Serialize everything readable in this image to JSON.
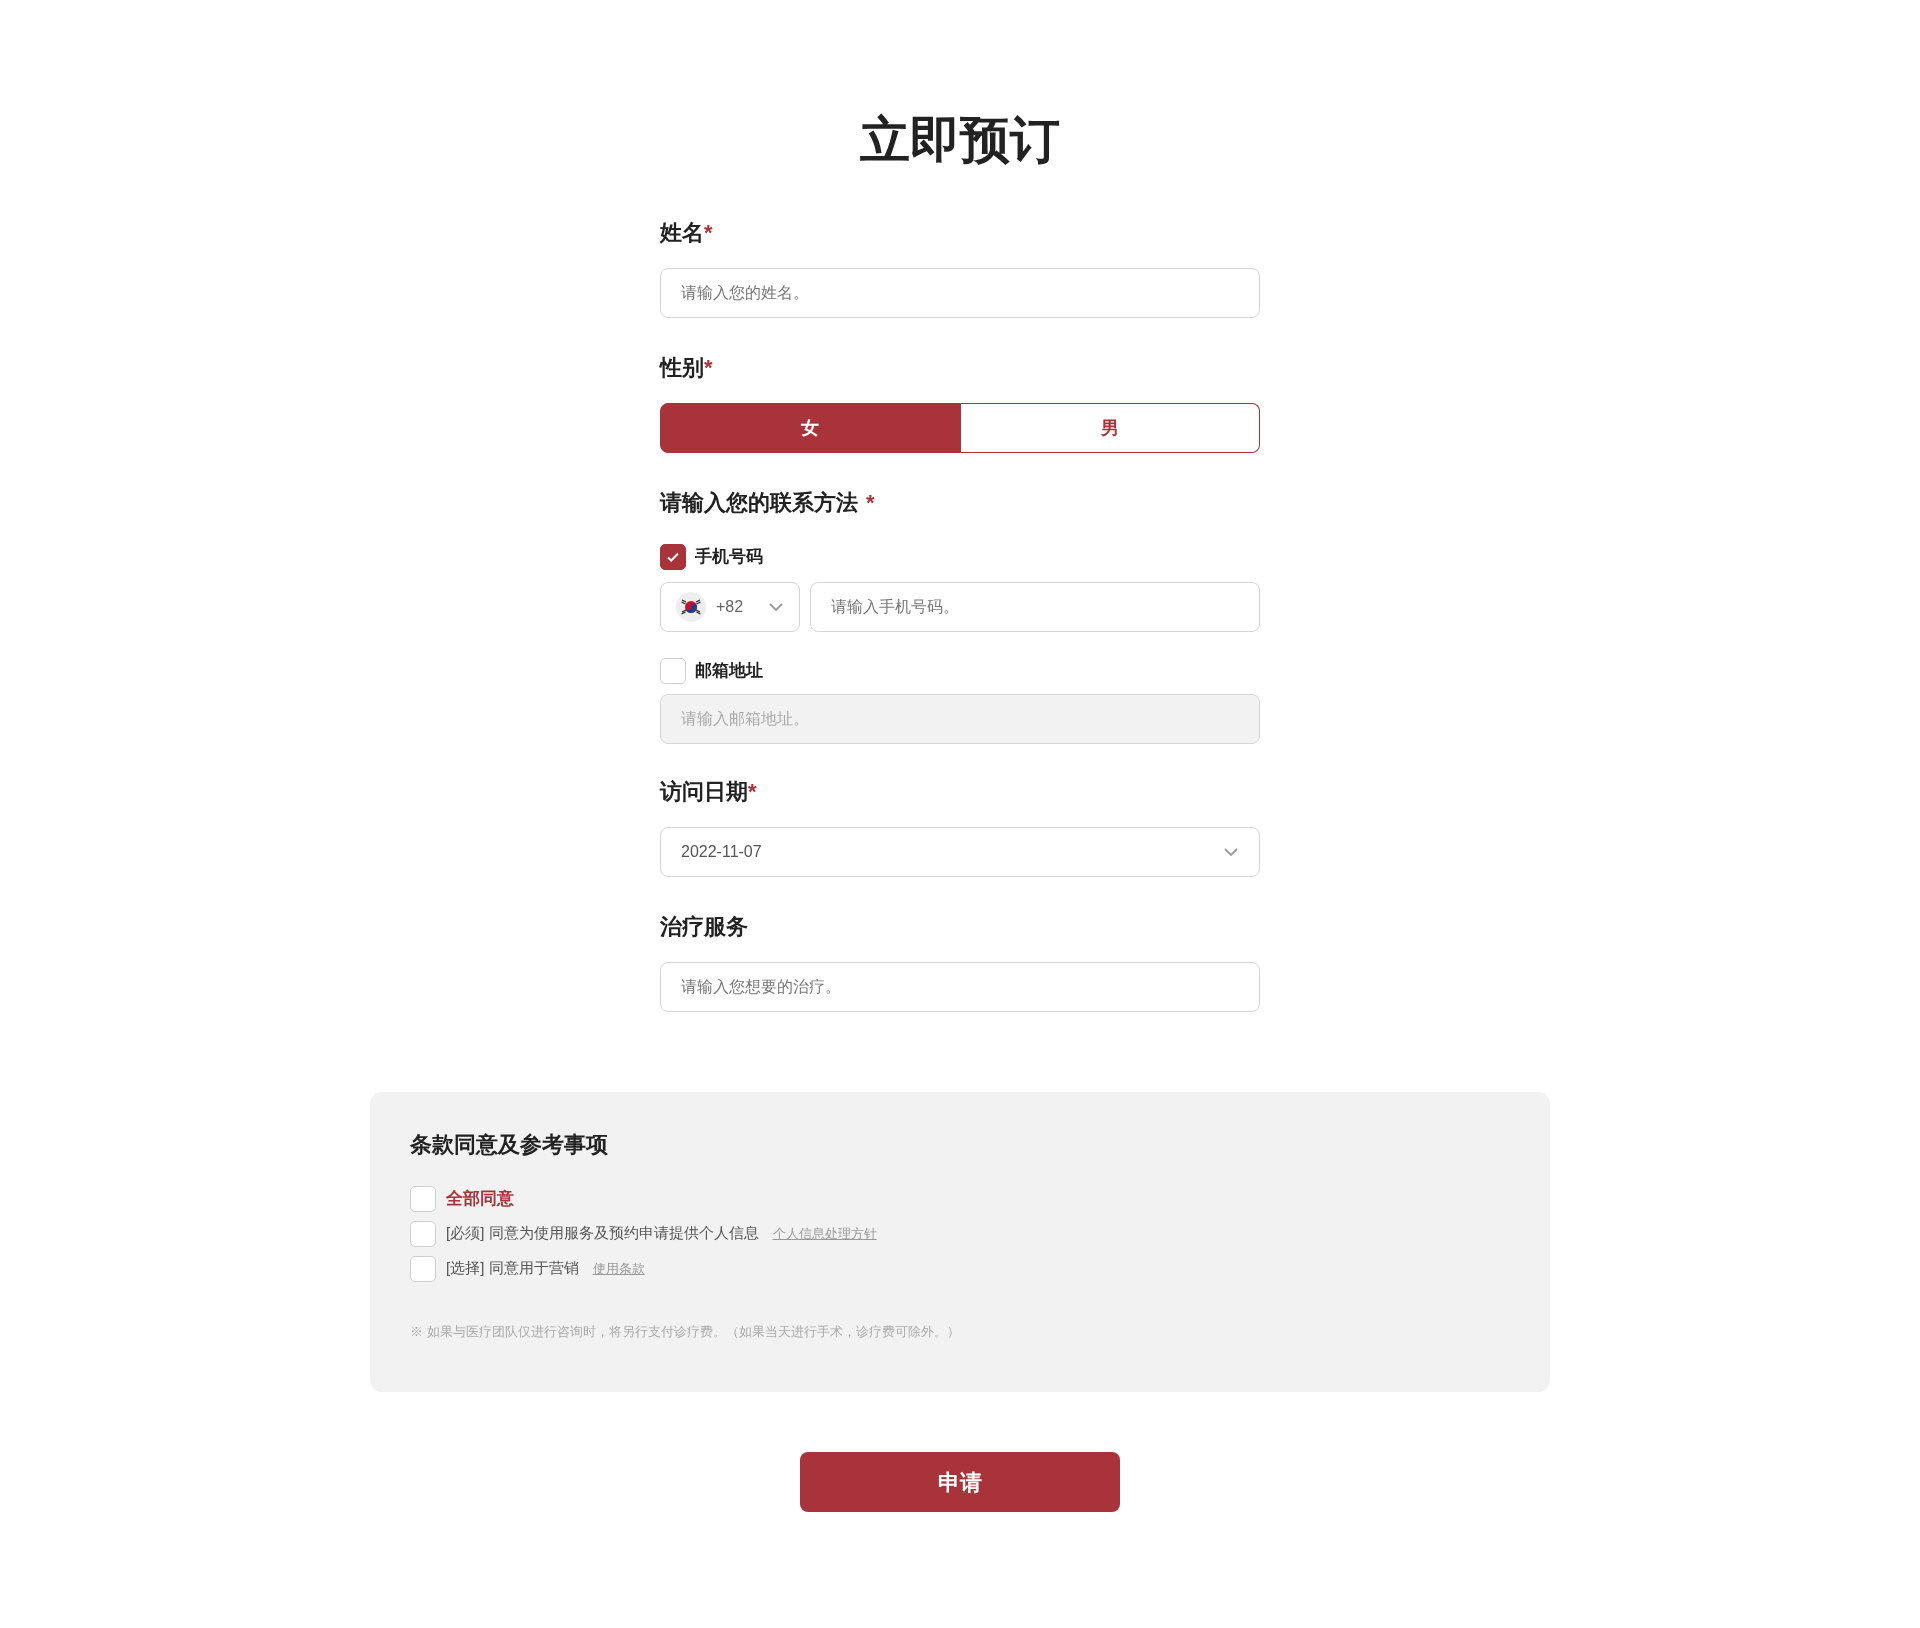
{
  "title": "立即预订",
  "name_field": {
    "label": "姓名",
    "required_mark": "*",
    "placeholder": "请输入您的姓名。"
  },
  "gender": {
    "label": "性别",
    "required_mark": "*",
    "options": [
      {
        "label": "女",
        "selected": true
      },
      {
        "label": "男",
        "selected": false
      }
    ]
  },
  "contact": {
    "label": "请输入您的联系方法",
    "required_mark": "*",
    "methods": [
      {
        "kind": "phone",
        "label": "手机号码",
        "checked": true,
        "country_code": "+82",
        "placeholder": "请输入手机号码。"
      },
      {
        "kind": "email",
        "label": "邮箱地址",
        "checked": false,
        "placeholder": "请输入邮箱地址。"
      }
    ]
  },
  "visit_date": {
    "label": "访问日期",
    "required_mark": "*",
    "value": "2022-11-07"
  },
  "treatment": {
    "label": "治疗服务",
    "placeholder": "请输入您想要的治疗。"
  },
  "terms": {
    "title": "条款同意及参考事项",
    "items": [
      {
        "kind": "all",
        "text": "全部同意",
        "checked": false
      },
      {
        "kind": "item",
        "text": "[必须] 同意为使用服务及预约申请提供个人信息",
        "link": "个人信息处理方针",
        "checked": false
      },
      {
        "kind": "item",
        "text": "[选择] 同意用于营销",
        "link": "使用条款",
        "checked": false
      }
    ],
    "note": "※ 如果与医疗团队仅进行咨询时，将另行支付诊疗费。（如果当天进行手术，诊疗费可除外。）"
  },
  "submit": "申请"
}
